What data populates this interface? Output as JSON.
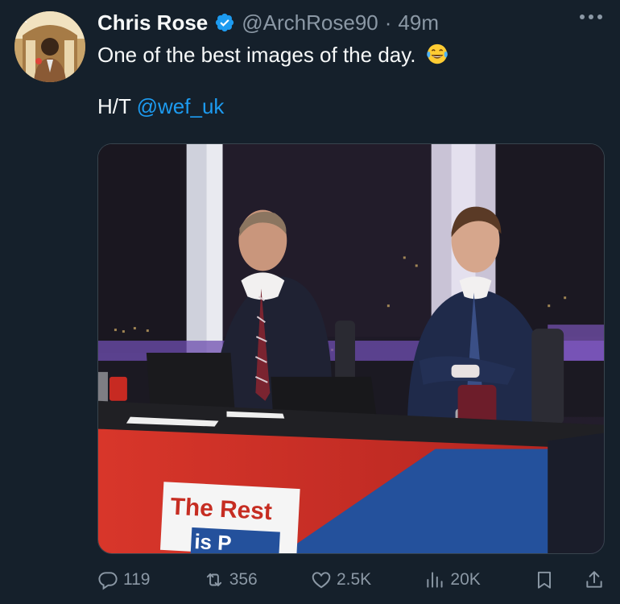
{
  "author": {
    "display_name": "Chris Rose",
    "handle": "@ArchRose90",
    "separator": "·",
    "time": "49m",
    "verified": true
  },
  "tweet": {
    "line1": "One of the best images of the day.",
    "line1_emoji": "face-with-tears-of-joy",
    "ht_prefix": "H/T ",
    "mention": "@wef_uk"
  },
  "media": {
    "desk_banner_text": "The Rest",
    "desk_banner_text2": "is P"
  },
  "actions": {
    "replies": "119",
    "reposts": "356",
    "likes": "2.5K",
    "views": "20K"
  },
  "colors": {
    "background": "#15202b",
    "text": "#f7f9f9",
    "secondary": "#8b98a5",
    "link": "#1d9bf0",
    "verified": "#1d9bf0"
  }
}
